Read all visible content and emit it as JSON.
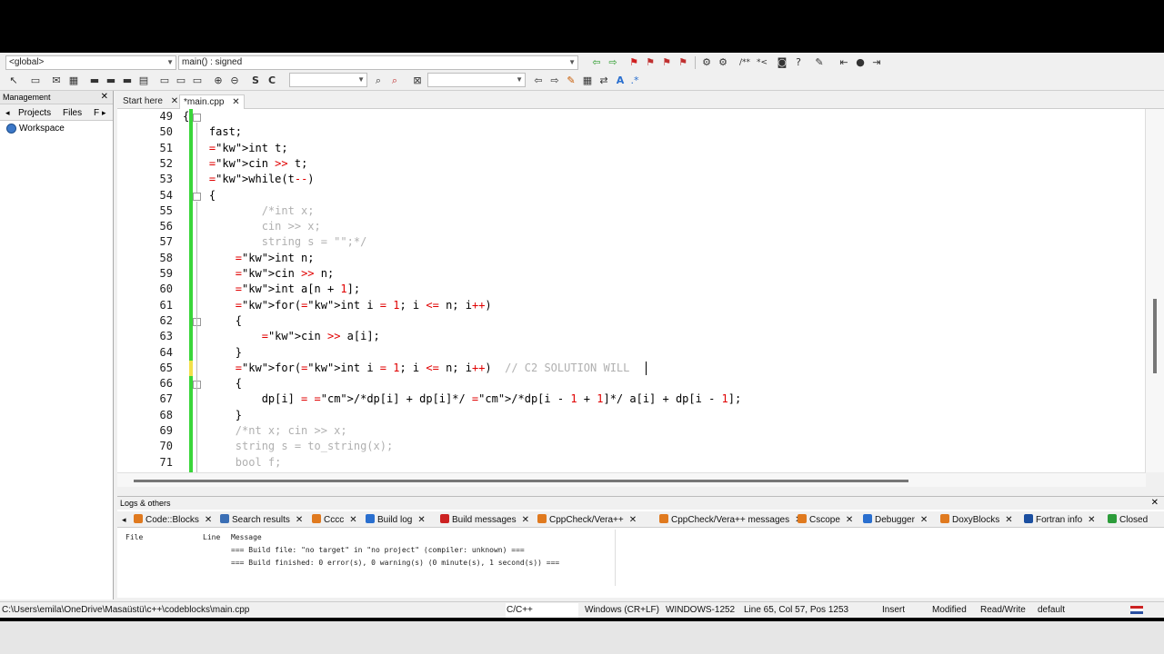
{
  "toolbar": {
    "scope": "<global>",
    "function": "main() : signed",
    "search_combo": "",
    "search_combo2": ""
  },
  "management": {
    "title": "Management",
    "tabs": [
      "Projects",
      "Files",
      "F"
    ],
    "workspace": "Workspace"
  },
  "editor_tabs": [
    {
      "label": "Start here"
    },
    {
      "label": "*main.cpp"
    }
  ],
  "editor": {
    "lines": [
      {
        "n": "49",
        "code": "{"
      },
      {
        "n": "50",
        "code": "    fast;"
      },
      {
        "n": "51",
        "code": "    int t;"
      },
      {
        "n": "52",
        "code": "    cin >> t;"
      },
      {
        "n": "53",
        "code": "    while(t--)"
      },
      {
        "n": "54",
        "code": "    {"
      },
      {
        "n": "55",
        "code": "            /*int x;"
      },
      {
        "n": "56",
        "code": "            cin >> x;"
      },
      {
        "n": "57",
        "code": "            string s = \"\";*/"
      },
      {
        "n": "58",
        "code": "        int n;"
      },
      {
        "n": "59",
        "code": "        cin >> n;"
      },
      {
        "n": "60",
        "code": "        int a[n + 1];"
      },
      {
        "n": "61",
        "code": "        for(int i = 1; i <= n; i++)"
      },
      {
        "n": "62",
        "code": "        {"
      },
      {
        "n": "63",
        "code": "            cin >> a[i];"
      },
      {
        "n": "64",
        "code": "        }"
      },
      {
        "n": "65",
        "code": "        for(int i = 1; i <= n; i++)  // C2 SOLUTION WILL"
      },
      {
        "n": "66",
        "code": "        {"
      },
      {
        "n": "67",
        "code": "            dp[i] = /*dp[i] + dp[i]*/ /*dp[i - 1 + 1]*/ a[i] + dp[i - 1];"
      },
      {
        "n": "68",
        "code": "        }"
      },
      {
        "n": "69",
        "code": "        /*nt x; cin >> x;"
      },
      {
        "n": "70",
        "code": "        string s = to_string(x);"
      },
      {
        "n": "71",
        "code": "        bool f;"
      }
    ]
  },
  "logs": {
    "title": "Logs & others",
    "tabs": [
      {
        "label": "Code::Blocks",
        "color": "#e07a1f"
      },
      {
        "label": "Search results",
        "color": "#3b6fb5"
      },
      {
        "label": "Cccc",
        "color": "#e07a1f"
      },
      {
        "label": "Build log",
        "color": "#2a6fcf"
      },
      {
        "label": "Build messages",
        "color": "#c22"
      },
      {
        "label": "CppCheck/Vera++",
        "color": "#e07a1f"
      },
      {
        "label": "CppCheck/Vera++ messages",
        "color": "#e07a1f"
      },
      {
        "label": "Cscope",
        "color": "#e07a1f"
      },
      {
        "label": "Debugger",
        "color": "#2a6fcf"
      },
      {
        "label": "DoxyBlocks",
        "color": "#e07a1f"
      },
      {
        "label": "Fortran info",
        "color": "#1b4fa0"
      },
      {
        "label": "Closed",
        "color": "#2c9c3a"
      }
    ],
    "headers": {
      "file": "File",
      "line": "Line",
      "message": "Message"
    },
    "rows": [
      "=== Build file: \"no target\" in \"no project\" (compiler: unknown) ===",
      "=== Build finished: 0 error(s), 0 warning(s) (0 minute(s), 1 second(s)) ==="
    ]
  },
  "status": {
    "path": "C:\\Users\\emila\\OneDrive\\Masaüstü\\c++\\codeblocks\\main.cpp",
    "language": "C/C++",
    "eol": "Windows (CR+LF)",
    "encoding": "WINDOWS-1252",
    "position": "Line 65, Col 57, Pos 1253",
    "mode": "Insert",
    "modified": "Modified",
    "rw": "Read/Write",
    "profile": "default"
  }
}
